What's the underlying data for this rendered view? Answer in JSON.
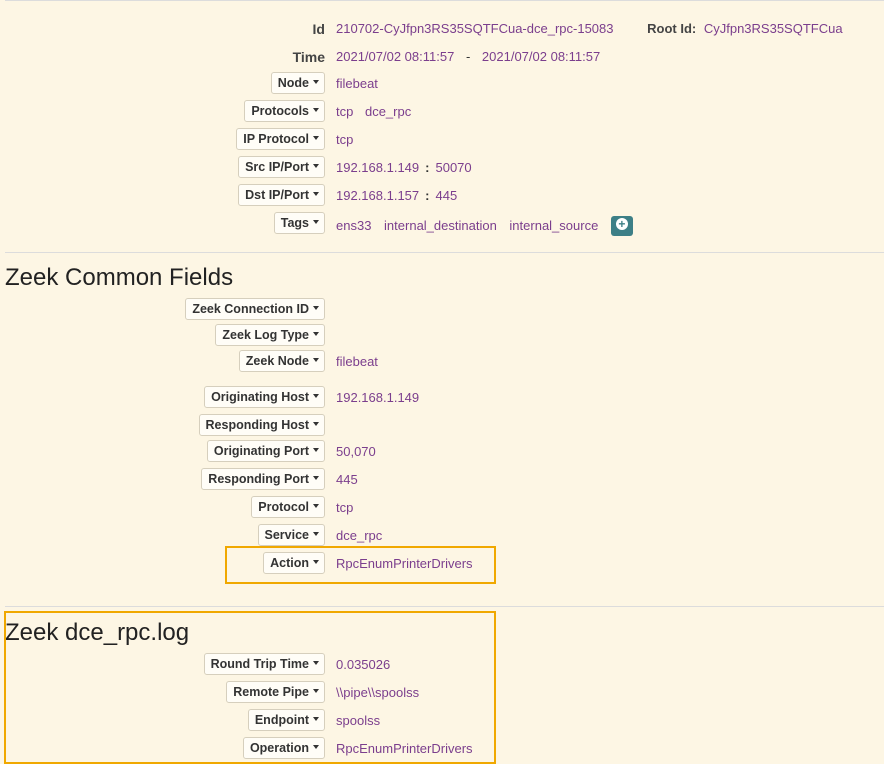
{
  "session": {
    "id_label": "Id",
    "id_value": "210702-CyJfpn3RS35SQTFCua-dce_rpc-15083",
    "root_id_label": "Root Id:",
    "root_id_value": "CyJfpn3RS35SQTFCua",
    "time_label": "Time",
    "time_start": "2021/07/02 08:11:57",
    "time_sep": "-",
    "time_end": "2021/07/02 08:11:57",
    "node_label": "Node",
    "node_value": "filebeat",
    "protocols_label": "Protocols",
    "protocols": [
      "tcp",
      "dce_rpc"
    ],
    "ip_protocol_label": "IP Protocol",
    "ip_protocol_value": "tcp",
    "src_label": "Src IP/Port",
    "src_ip": "192.168.1.149",
    "src_port": "50070",
    "dst_label": "Dst IP/Port",
    "dst_ip": "192.168.1.157",
    "dst_port": "445",
    "colon": ":",
    "tags_label": "Tags",
    "tags": [
      "ens33",
      "internal_destination",
      "internal_source"
    ]
  },
  "zeek_common": {
    "title": "Zeek Common Fields",
    "connection_id_label": "Zeek Connection ID",
    "log_type_label": "Zeek Log Type",
    "node_label": "Zeek Node",
    "node_value": "filebeat",
    "orig_host_label": "Originating Host",
    "orig_host_value": "192.168.1.149",
    "resp_host_label": "Responding Host",
    "orig_port_label": "Originating Port",
    "orig_port_value": "50,070",
    "resp_port_label": "Responding Port",
    "resp_port_value": "445",
    "protocol_label": "Protocol",
    "protocol_value": "tcp",
    "service_label": "Service",
    "service_value": "dce_rpc",
    "action_label": "Action",
    "action_value": "RpcEnumPrinterDrivers"
  },
  "zeek_dce_rpc": {
    "title": "Zeek dce_rpc.log",
    "rtt_label": "Round Trip Time",
    "rtt_value": "0.035026",
    "pipe_label": "Remote Pipe",
    "pipe_value": "\\\\pipe\\\\spoolss",
    "endpoint_label": "Endpoint",
    "endpoint_value": "spoolss",
    "operation_label": "Operation",
    "operation_value": "RpcEnumPrinterDrivers"
  },
  "colors": {
    "value_link": "#7b3e8d",
    "highlight": "#f0a800",
    "add_button": "#3d7f86",
    "background": "#fdf6e4"
  },
  "icons": {
    "dropdown": "caret-down-icon",
    "add_tag": "plus-circle-icon"
  }
}
